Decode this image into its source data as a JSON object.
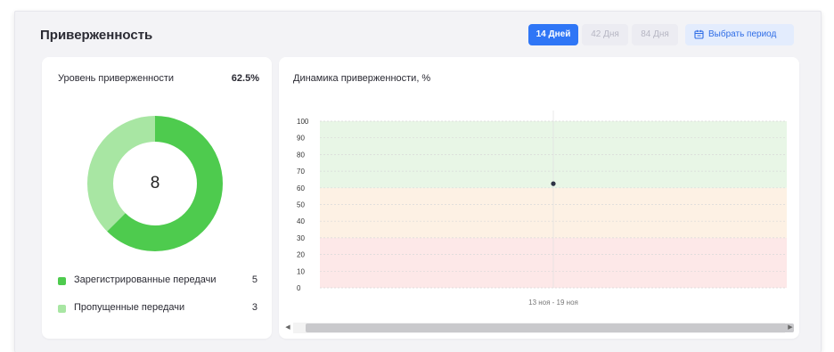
{
  "header": {
    "title": "Приверженность",
    "ranges": [
      "14 Дней",
      "42 Дня",
      "84 Дня"
    ],
    "active_range_index": 0,
    "period_button": "Выбрать период"
  },
  "adherence": {
    "label": "Уровень приверженности",
    "percent": "62.5%",
    "total": "8",
    "legend": [
      {
        "label": "Зарегистрированные передачи",
        "count": "5",
        "color": "#4ecb4e"
      },
      {
        "label": "Пропущенные передачи",
        "count": "3",
        "color": "#a8e6a3"
      }
    ]
  },
  "dynamics": {
    "title": "Динамика приверженности, %"
  },
  "chart_data": [
    {
      "type": "pie",
      "labels": [
        "Зарегистрированные передачи",
        "Пропущенные передачи"
      ],
      "values": [
        5,
        3
      ],
      "colors": [
        "#4ecb4e",
        "#a8e6a3"
      ],
      "center_label": "8"
    },
    {
      "type": "scatter",
      "title": "Динамика приверженности, %",
      "categories": [
        "13 ноя - 19 ноя"
      ],
      "series": [
        {
          "values": [
            62.5
          ]
        }
      ],
      "ylim": [
        0,
        100
      ],
      "yticks": [
        0,
        10,
        20,
        30,
        40,
        50,
        60,
        70,
        80,
        90,
        100
      ],
      "bands": [
        {
          "from": 0,
          "to": 30,
          "color": "#fde8e8"
        },
        {
          "from": 30,
          "to": 60,
          "color": "#fdf1e4"
        },
        {
          "from": 60,
          "to": 100,
          "color": "#e8f6e6"
        }
      ],
      "grid": true
    }
  ]
}
